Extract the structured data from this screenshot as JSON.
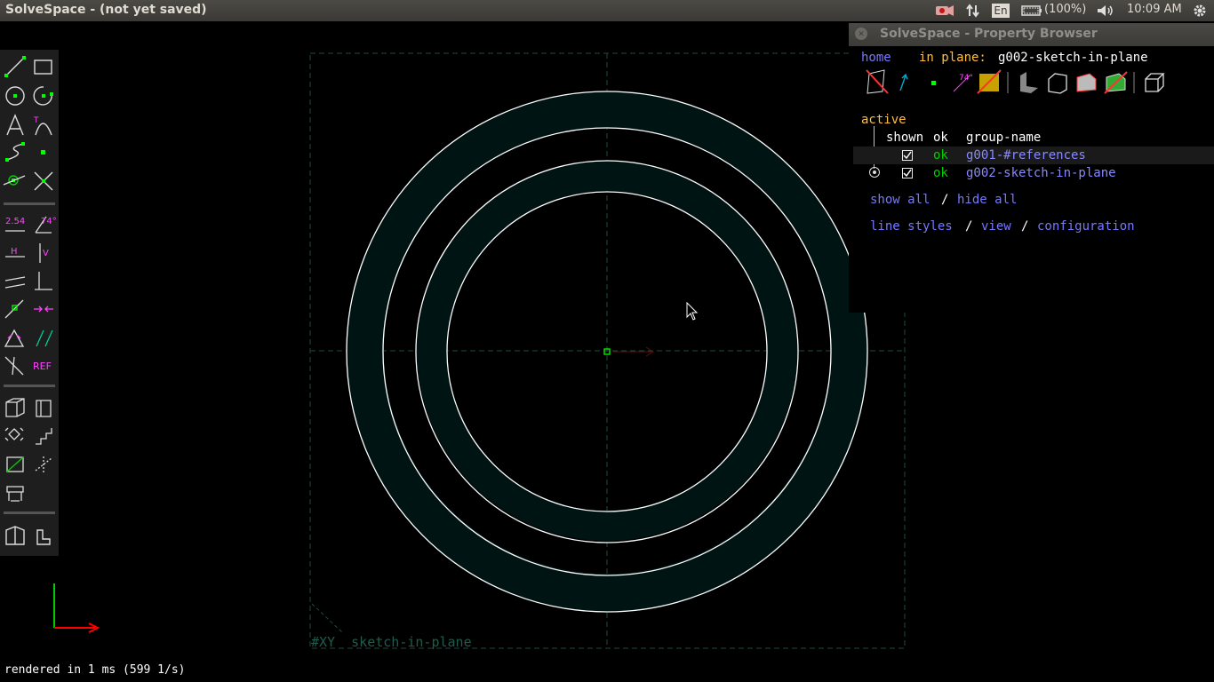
{
  "system_bar": {
    "title": "SolveSpace - (not yet saved)",
    "keyboard": "En",
    "battery": "(100%)",
    "time": "10:09 AM",
    "icons": [
      "record-icon",
      "network-icon",
      "keyboard-icon",
      "battery-icon",
      "volume-icon",
      "settings-gear-icon"
    ]
  },
  "property_browser": {
    "window_title": "SolveSpace - Property Browser",
    "nav": {
      "home": "home",
      "in_plane_label": "in plane:",
      "workplane": "g002-sketch-in-plane"
    },
    "toolbar_icons": [
      "show-workplanes-icon",
      "show-normals-icon",
      "show-points-icon",
      "show-constraints-icon",
      "show-faces-icon",
      "show-shaded-icon",
      "show-edges-icon",
      "show-outlines-icon",
      "show-mesh-icon",
      "show-hidden-icon"
    ],
    "active_label": "active",
    "columns": {
      "shown": "shown",
      "ok": "ok",
      "group": "group-name"
    },
    "groups": [
      {
        "ok": "ok",
        "name": "g001-#references",
        "shown": true,
        "active": false
      },
      {
        "ok": "ok",
        "name": "g002-sketch-in-plane",
        "shown": true,
        "active": true
      }
    ],
    "show_all": "show all",
    "slash": "/",
    "hide_all": "hide all",
    "line_styles": "line styles",
    "view": "view",
    "configuration": "configuration"
  },
  "canvas": {
    "workplane_label": "#XY  sketch-in-plane",
    "colors": {
      "line": "#ffffff",
      "fill": "#001414",
      "workplane": "#1f4a3c",
      "point": "#00ff00",
      "axis_x": "#ff0000",
      "axis_y": "#00cc00"
    }
  },
  "toolbar": {
    "tools": [
      "line-tool-icon",
      "rectangle-tool-icon",
      "circle-tool-icon",
      "arc-tool-icon",
      "text-tool-icon",
      "tangent-arc-tool-icon",
      "cubic-spline-tool-icon",
      "datum-point-tool-icon",
      "workplane-tool-icon",
      "split-curves-tool-icon",
      "distance-constraint-icon",
      "angle-constraint-icon",
      "horizontal-constraint-icon",
      "vertical-constraint-icon",
      "parallel-constraint-icon",
      "perpendicular-constraint-icon",
      "point-on-line-constraint-icon",
      "symmetric-constraint-icon",
      "equal-constraint-icon",
      "same-orientation-constraint-icon",
      "other-supplementary-icon",
      "reference-toggle-icon",
      "nearest-iso-view-icon",
      "nearest-ortho-view-icon",
      "step-rotate-icon",
      "step-translate-icon",
      "extrude-icon",
      "lathe-icon",
      "sketch-in-plane-icon",
      "sketch-in-3d-icon"
    ],
    "distance_label": "2.54",
    "angle_label": "74°",
    "h_label": "H",
    "v_label": "V",
    "ref_label": "REF"
  },
  "status": {
    "text": "rendered in 1 ms (599 1/s)"
  }
}
